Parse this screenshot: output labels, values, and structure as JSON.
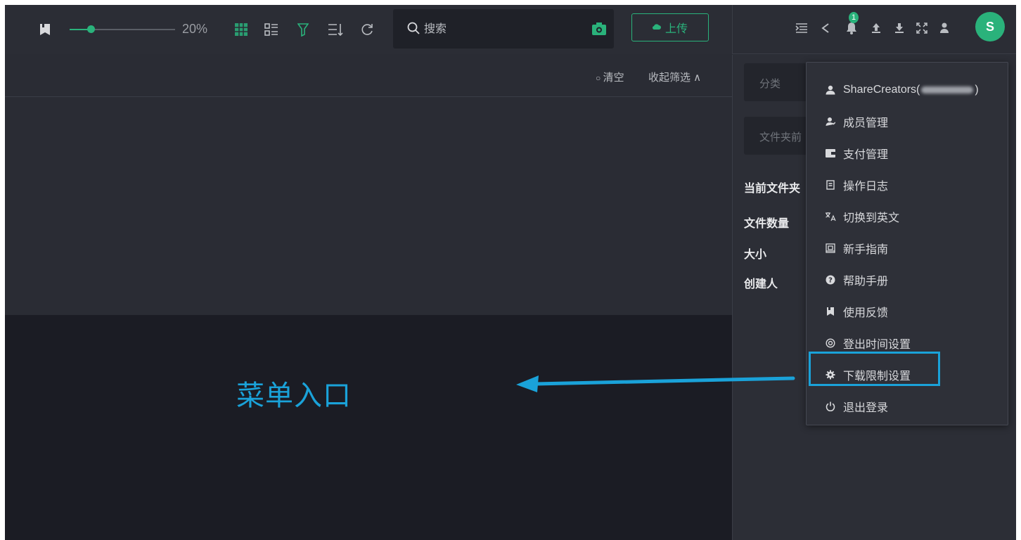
{
  "toolbar": {
    "zoom_label": "20%",
    "zoom_level_percent": 20,
    "search_placeholder": "搜索",
    "upload_label": "上传",
    "accent": "#2ab27b"
  },
  "header": {
    "notification_count": "1",
    "avatar_letter": "S"
  },
  "filters": {
    "clear_label": "清空",
    "collapse_label": "收起筛选 ∧"
  },
  "annotation": {
    "text": "菜单入口",
    "color": "#1aa2d9"
  },
  "right_panel": {
    "category_placeholder": "分类",
    "folder_placeholder": "文件夹前",
    "current_folder_label": "当前文件夹",
    "file_count_label": "文件数量",
    "size_label": "大小",
    "creator_label": "创建人"
  },
  "menu": {
    "items": [
      {
        "icon": "user-icon",
        "label": "ShareCreators(",
        "suffix": ")"
      },
      {
        "icon": "members-icon",
        "label": "成员管理"
      },
      {
        "icon": "wallet-icon",
        "label": "支付管理"
      },
      {
        "icon": "log-icon",
        "label": "操作日志"
      },
      {
        "icon": "translate-icon",
        "label": "切换到英文"
      },
      {
        "icon": "guide-icon",
        "label": "新手指南"
      },
      {
        "icon": "help-icon",
        "label": "帮助手册"
      },
      {
        "icon": "feedback-icon",
        "label": "使用反馈"
      },
      {
        "icon": "timer-icon",
        "label": "登出时间设置"
      },
      {
        "icon": "gear-icon",
        "label": "下载限制设置"
      },
      {
        "icon": "power-icon",
        "label": "退出登录"
      }
    ],
    "highlighted_index": 9
  }
}
